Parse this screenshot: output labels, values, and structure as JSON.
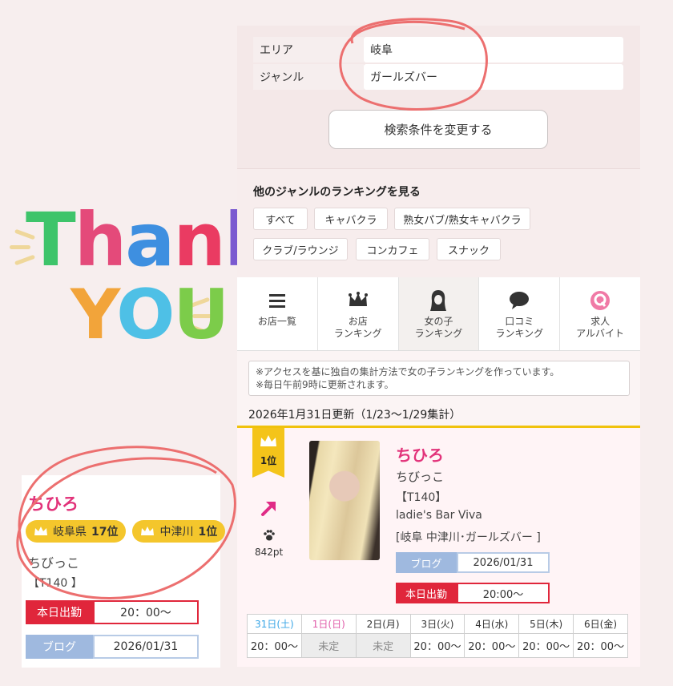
{
  "sticker": {
    "line1": [
      "T",
      "h",
      "a",
      "n",
      "k"
    ],
    "line2": [
      "Y",
      "O",
      "U"
    ]
  },
  "left_card": {
    "name": "ちひろ",
    "badges": [
      {
        "icon": "crown-icon",
        "label": "岐阜県",
        "rank": "17位"
      },
      {
        "icon": "crown-icon",
        "label": "中津川",
        "rank": "1位"
      }
    ],
    "subtitle": "ちびっこ",
    "size": "【T140 】",
    "today_label": "本日出勤",
    "today_value": "20：00〜",
    "blog_label": "ブログ",
    "blog_value": "2026/01/31"
  },
  "search": {
    "rows": [
      {
        "label": "エリア",
        "value": "岐阜"
      },
      {
        "label": "ジャンル",
        "value": "ガールズバー"
      }
    ],
    "change_button": "検索条件を変更する"
  },
  "genre": {
    "title": "他のジャンルのランキングを見る",
    "chips": [
      "すべて",
      "キャバクラ",
      "熟女パブ/熟女キャバクラ",
      "クラブ/ラウンジ",
      "コンカフェ",
      "スナック"
    ]
  },
  "nav": [
    {
      "icon": "list-icon",
      "label": "お店一覧"
    },
    {
      "icon": "crown-icon",
      "label": "お店\nランキング"
    },
    {
      "icon": "girl-icon",
      "label": "女の子\nランキング",
      "active": true
    },
    {
      "icon": "speech-bubble-icon",
      "label": "口コミ\nランキング"
    },
    {
      "icon": "q-icon",
      "label": "求人\nアルバイト"
    }
  ],
  "note": {
    "line1": "※アクセスを基に独自の集計方法で女の子ランキングを作っています。",
    "line2": "※毎日午前9時に更新されます。"
  },
  "updated": "2026年1月31日更新（1/23〜1/29集計）",
  "entry": {
    "rank": "1位",
    "points": "842pt",
    "name": "ちひろ",
    "subtitle": "ちびっこ",
    "size": "【T140】",
    "shop": "ladie's Bar Viva",
    "location": "[岐阜 中津川･ガールズバー ]",
    "blog_label": "ブログ",
    "blog_value": "2026/01/31",
    "today_label": "本日出勤",
    "today_value": "20:00〜"
  },
  "schedule": {
    "days": [
      "31日(土)",
      "1日(日)",
      "2日(月)",
      "3日(火)",
      "4日(水)",
      "5日(木)",
      "6日(金)"
    ],
    "values": [
      "20：00〜",
      "未定",
      "未定",
      "20：00〜",
      "20：00〜",
      "20：00〜",
      "20：00〜"
    ]
  },
  "colors": {
    "accent_pink": "#e2337a",
    "badge_yellow": "#f4c62c",
    "today_red": "#e0263b",
    "blog_blue": "#9fb9df",
    "circle_red": "#ec6f6f"
  }
}
